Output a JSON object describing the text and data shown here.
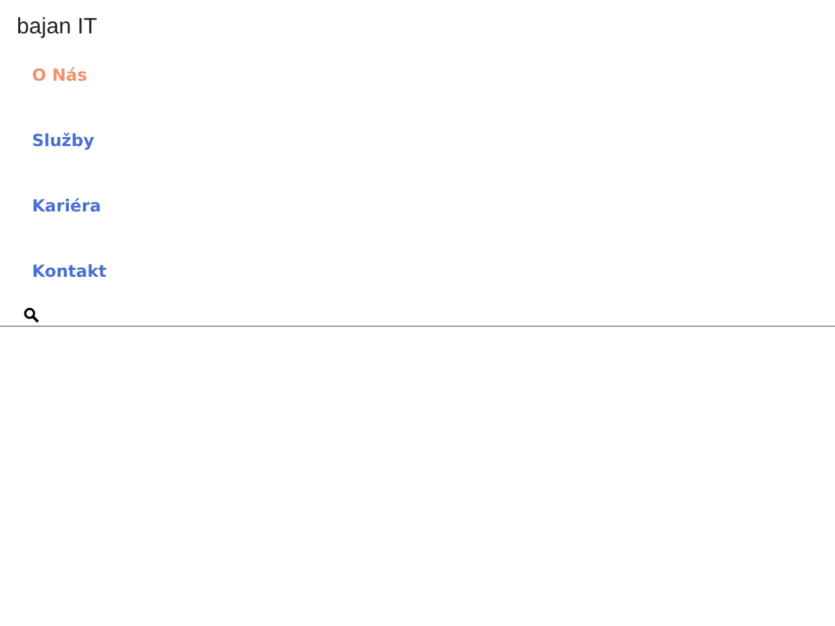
{
  "site_title": "bajan IT",
  "nav": [
    {
      "label": "O Nás",
      "selected": true
    },
    {
      "label": "Služby",
      "selected": false
    },
    {
      "label": "Kariéra",
      "selected": false
    },
    {
      "label": "Kontakt",
      "selected": false
    }
  ]
}
